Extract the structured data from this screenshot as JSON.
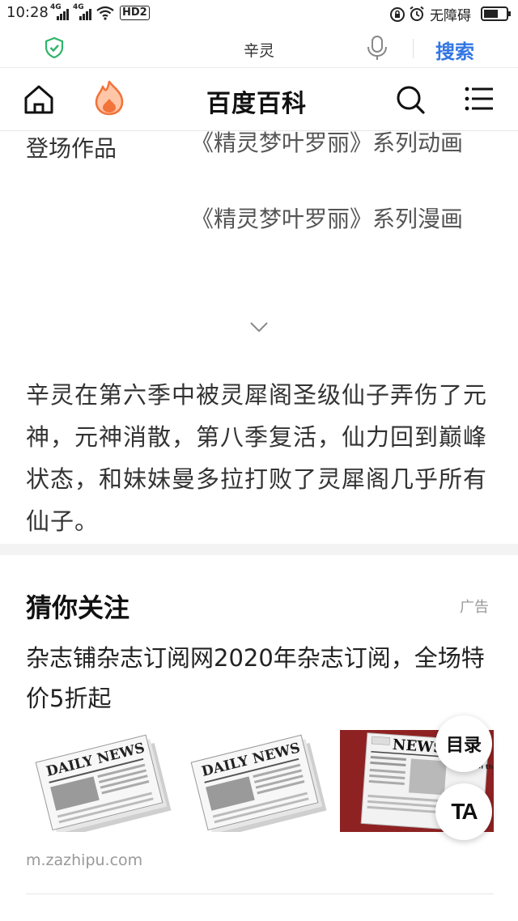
{
  "status_bar": {
    "time": "10:28",
    "network_1": "4G",
    "network_2": "4G",
    "hd_badge": "HD2",
    "accessibility_label": "无障碍"
  },
  "search_bar": {
    "query": "辛灵",
    "search_button": "搜索",
    "shield_icon": "shield-check-icon",
    "mic_icon": "microphone-icon",
    "accent_color": "#3276e3"
  },
  "header": {
    "title": "百度百科",
    "home_icon": "home-icon",
    "fire_icon": "hot-flame-icon",
    "search_icon": "search-icon",
    "menu_icon": "menu-icon"
  },
  "info_row": {
    "label": "登场作品",
    "works": [
      "《精灵梦叶罗丽》系列动画",
      "《精灵梦叶罗丽》系列漫画"
    ]
  },
  "description": "辛灵在第六季中被灵犀阁圣级仙子弄伤了元神，元神消散，第八季复活，仙力回到巅峰状态，和妹妹曼多拉打败了灵犀阁几乎所有仙子。",
  "recommend": {
    "title": "猜你关注",
    "ad_label": "广告",
    "headline": "杂志铺杂志订阅网2020年杂志订阅，全场特价5折起",
    "url": "m.zazhipu.com",
    "image_1_text": "DAILY NEWS",
    "image_2_text": "DAILY NEWS",
    "image_3_text": "NEWS",
    "image_3_sub": "Events in the"
  },
  "floating": {
    "toc": "目录",
    "ta": "TA"
  }
}
